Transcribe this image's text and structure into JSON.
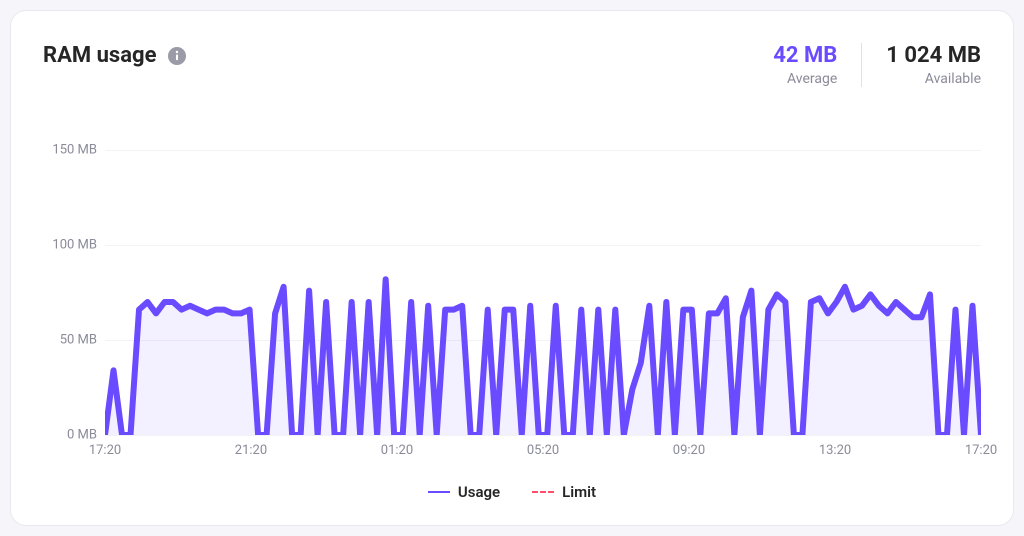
{
  "title": "RAM usage",
  "stats": {
    "average": {
      "value": "42 MB",
      "label": "Average"
    },
    "available": {
      "value": "1 024 MB",
      "label": "Available"
    }
  },
  "legend": {
    "usage": "Usage",
    "limit": "Limit"
  },
  "colors": {
    "accent": "#6a4bff",
    "limit": "#ff4d6a"
  },
  "chart_data": {
    "type": "area",
    "ylabel": "MB",
    "ylim": [
      0,
      160
    ],
    "y_ticks": [
      {
        "v": 0,
        "label": "0 MB"
      },
      {
        "v": 50,
        "label": "50 MB"
      },
      {
        "v": 100,
        "label": "100 MB"
      },
      {
        "v": 150,
        "label": "150 MB"
      }
    ],
    "x_ticks": [
      "17:20",
      "21:20",
      "01:20",
      "05:20",
      "09:20",
      "13:20",
      "17:20"
    ],
    "series": [
      {
        "name": "Usage",
        "values": [
          0,
          34,
          0,
          0,
          66,
          70,
          64,
          70,
          70,
          66,
          68,
          66,
          64,
          66,
          66,
          64,
          64,
          66,
          0,
          0,
          64,
          78,
          0,
          0,
          76,
          0,
          70,
          0,
          0,
          70,
          0,
          70,
          0,
          82,
          0,
          0,
          70,
          0,
          68,
          0,
          66,
          66,
          68,
          0,
          0,
          66,
          0,
          66,
          66,
          0,
          68,
          0,
          0,
          68,
          0,
          0,
          66,
          0,
          66,
          0,
          66,
          0,
          24,
          38,
          68,
          0,
          70,
          0,
          66,
          66,
          0,
          64,
          64,
          72,
          0,
          62,
          76,
          0,
          66,
          74,
          70,
          0,
          0,
          70,
          72,
          64,
          70,
          78,
          66,
          68,
          74,
          68,
          64,
          70,
          66,
          62,
          62,
          74,
          0,
          0,
          66,
          0,
          68,
          0
        ]
      }
    ]
  }
}
